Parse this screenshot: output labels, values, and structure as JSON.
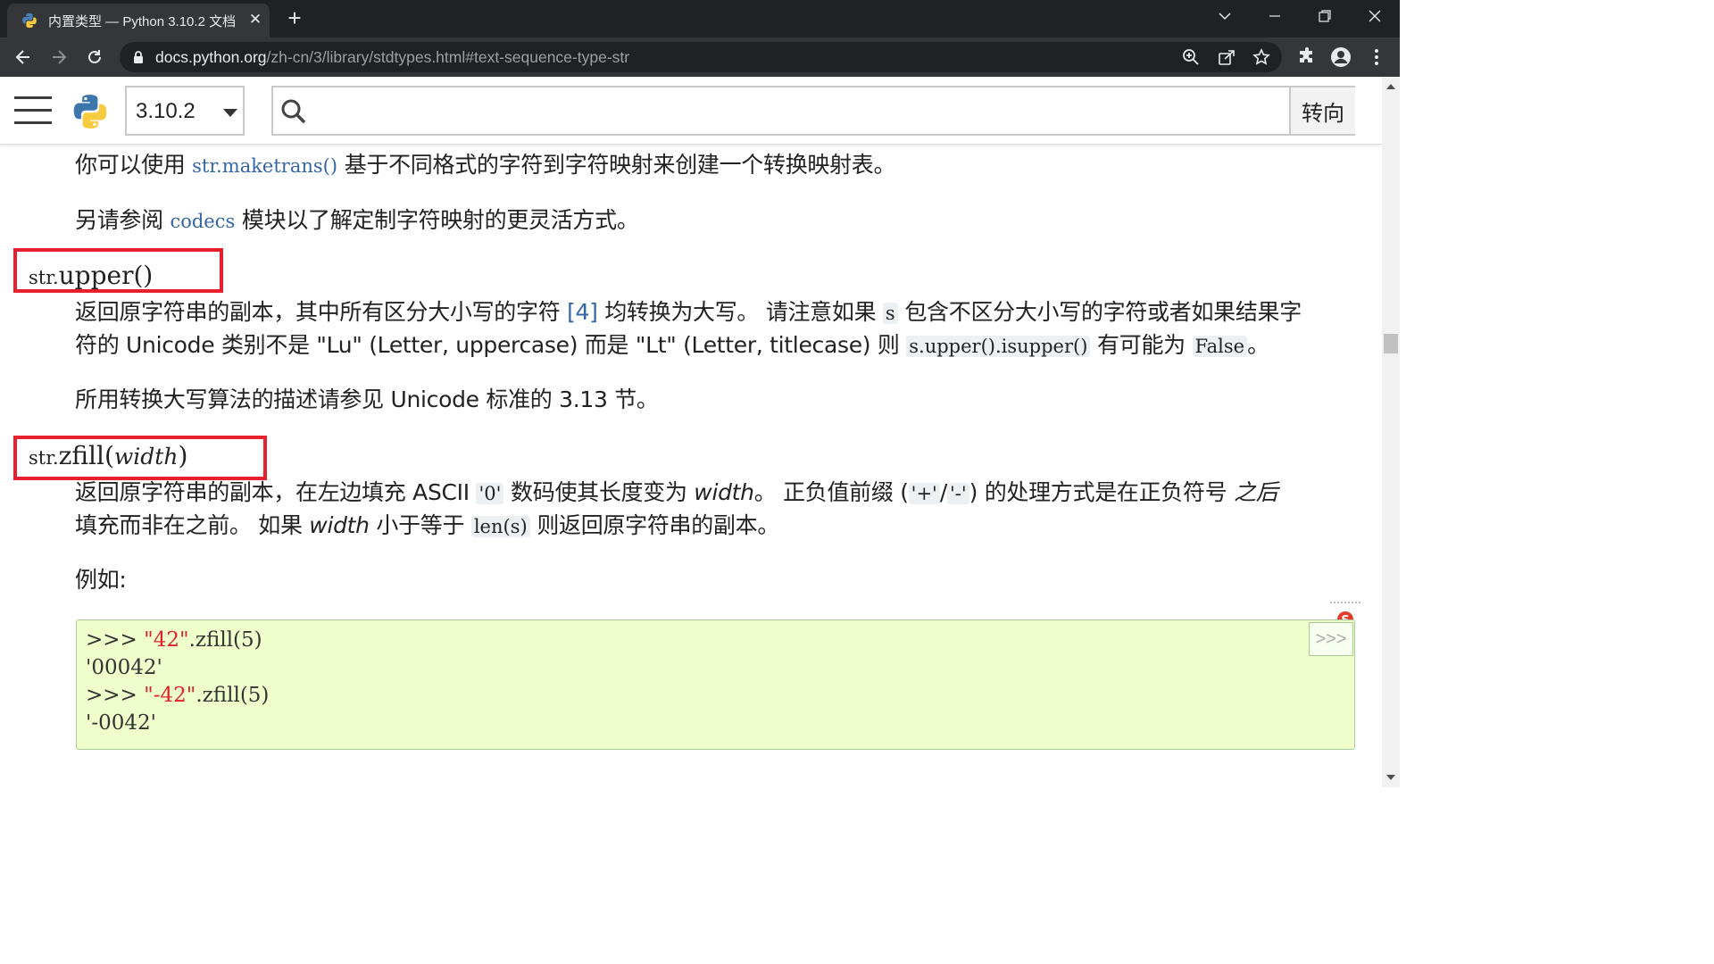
{
  "browser": {
    "tab_title": "内置类型 — Python 3.10.2 文档",
    "tab_close": "✕",
    "new_tab": "+",
    "url_host": "docs.python.org",
    "url_path": "/zh-cn/3/library/stdtypes.html#text-sequence-type-str"
  },
  "header": {
    "version": "3.10.2",
    "search_placeholder": "",
    "search_button": "转向"
  },
  "content": {
    "p1_before": "你可以使用 ",
    "p1_code": "str.maketrans()",
    "p1_after": " 基于不同格式的字符到字符映射来创建一个转换映射表。",
    "p2_before": "另请参阅 ",
    "p2_code": "codecs",
    "p2_after": " 模块以了解定制字符映射的更灵活方式。",
    "upper_sig": {
      "prefix": "str.",
      "name": "upper",
      "parens": "()"
    },
    "upper_desc_l1_a": "返回原字符串的副本，其中所有区分大小写的字符 ",
    "upper_desc_l1_ref": "[4]",
    "upper_desc_l1_b": " 均转换为大写。 请注意如果 ",
    "upper_desc_l1_code": "s",
    "upper_desc_l1_c": " 包含不区分大小写的字符或者如果结果字",
    "upper_desc_l2_a": "符的 Unicode 类别不是 \"Lu\" (Letter, uppercase) 而是 \"Lt\" (Letter, titlecase) 则 ",
    "upper_desc_l2_code": "s.upper().isupper()",
    "upper_desc_l2_b": " 有可能为 ",
    "upper_desc_l2_code2": "False",
    "upper_desc_l2_c": "。",
    "upper_note": "所用转换大写算法的描述请参见 Unicode 标准的 3.13 节。",
    "zfill_sig": {
      "prefix": "str.",
      "name": "zfill",
      "open": "(",
      "param": "width",
      "close": ")"
    },
    "zfill_desc_l1_a": "返回原字符串的副本，在左边填充 ASCII ",
    "zfill_desc_l1_code": "'0'",
    "zfill_desc_l1_b": " 数码使其长度变为 ",
    "zfill_desc_l1_em": "width",
    "zfill_desc_l1_c": "。 正负值前缀 (",
    "zfill_desc_l1_code2": "'+'",
    "zfill_desc_l1_d": "/",
    "zfill_desc_l1_code3": "'-'",
    "zfill_desc_l1_e": ") 的处理方式是在正负符号 ",
    "zfill_desc_l1_em2": "之后",
    "zfill_desc_l2_a": "填充而非在之前。 如果 ",
    "zfill_desc_l2_em": "width",
    "zfill_desc_l2_b": " 小于等于 ",
    "zfill_desc_l2_code": "len(s)",
    "zfill_desc_l2_c": " 则返回原字符串的副本。",
    "example_label": "例如:",
    "code_lines": [
      {
        "prompt": ">>> ",
        "str": "\"42\"",
        "rest": ".zfill(5)"
      },
      {
        "output": "'00042'"
      },
      {
        "prompt": ">>> ",
        "str": "\"-42\"",
        "rest": ".zfill(5)"
      },
      {
        "output": "'-0042'"
      }
    ],
    "copy_button": ">>>"
  }
}
